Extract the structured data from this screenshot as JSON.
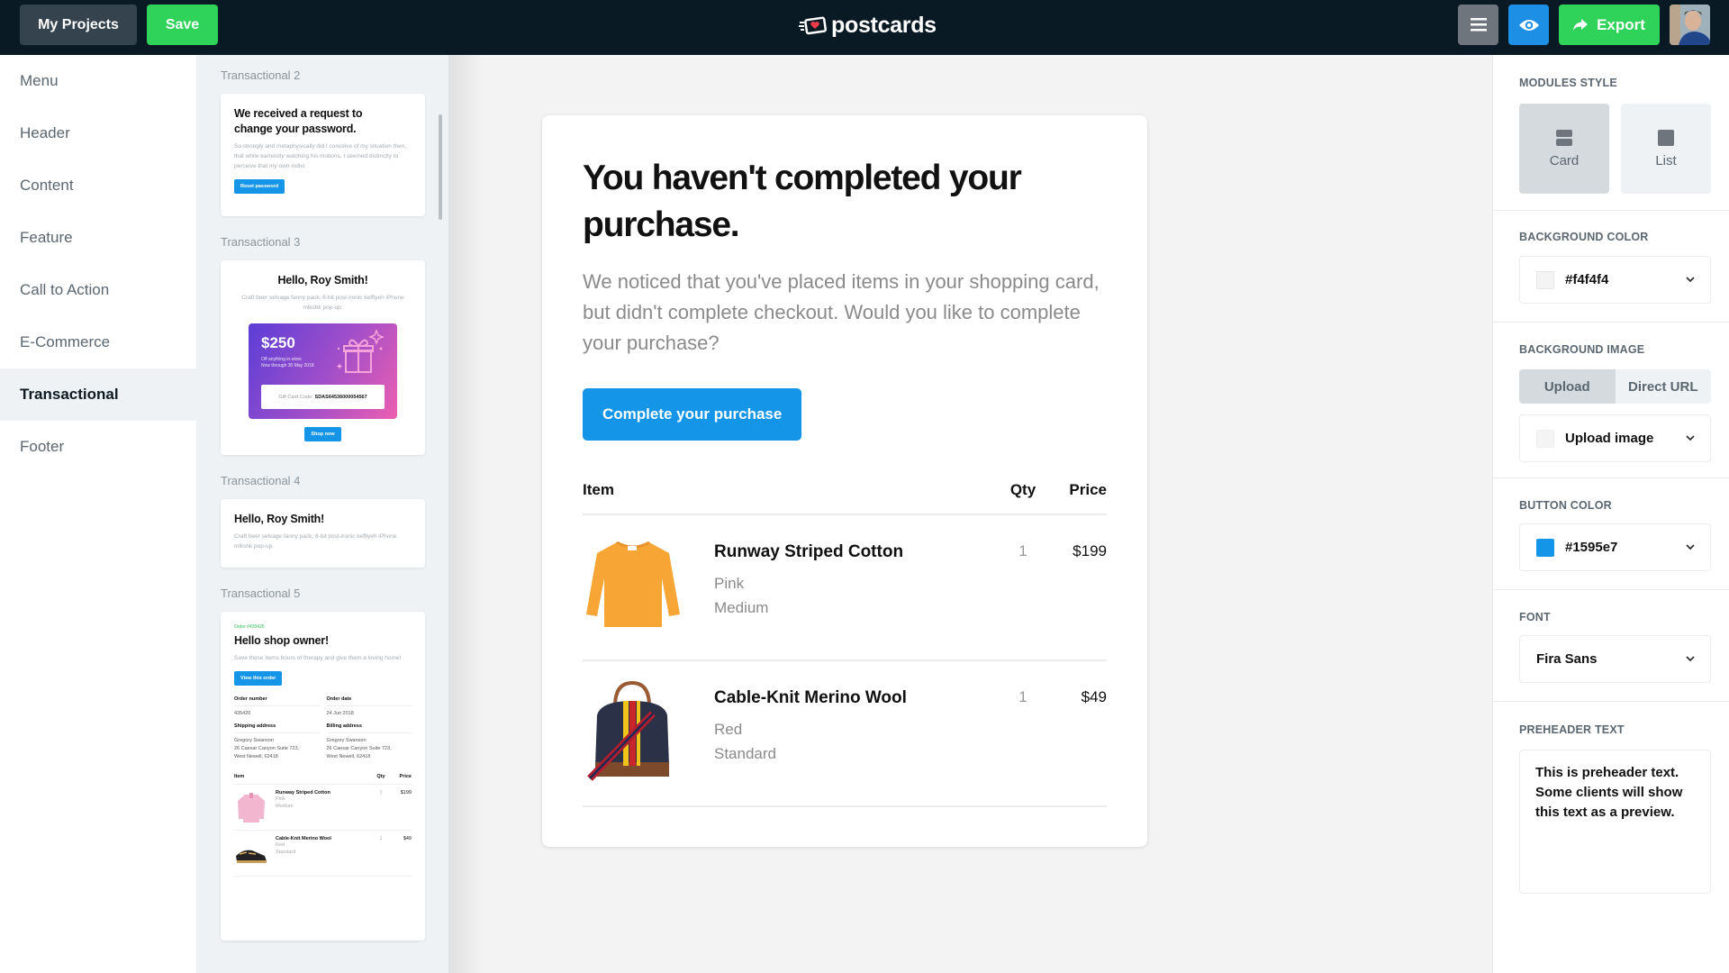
{
  "topbar": {
    "my_projects_label": "My Projects",
    "save_label": "Save",
    "logo_text": "postcards",
    "export_label": "Export"
  },
  "colors": {
    "topbar_bg": "#0a1a25",
    "save_green": "#2fd35a",
    "preview_blue": "#1d8fe4",
    "button_blue": "#1595e7"
  },
  "nav": {
    "items": [
      {
        "label": "Menu"
      },
      {
        "label": "Header"
      },
      {
        "label": "Content"
      },
      {
        "label": "Feature"
      },
      {
        "label": "Call to Action"
      },
      {
        "label": "E-Commerce"
      },
      {
        "label": "Transactional",
        "active": true
      },
      {
        "label": "Footer"
      }
    ]
  },
  "thumbnails": {
    "t2": {
      "label": "Transactional 2",
      "title": "We received a request to change your password.",
      "body": "So strongly and metaphysically did I conceive of my situation then, that while earnestly watching his motions, I seemed distinctly to perceive that my own indivi.",
      "button": "Reset password"
    },
    "t3": {
      "label": "Transactional 3",
      "title": "Hello, Roy Smith!",
      "body": "Craft beer selvage fanny pack, 8-bit post-ironic keffiyeh iPhone mlkshk pop-up.",
      "amount": "$250",
      "sub1": "Off anything in-store",
      "sub2": "Now through 30 May 2018",
      "code_label": "Gift Card Code:",
      "code_value": "SDAS64536000054567",
      "button": "Shop now"
    },
    "t4": {
      "label": "Transactional 4",
      "title": "Hello, Roy Smith!",
      "body": "Craft beer selvage fanny pack, 8-bit post-ironic keffiyeh iPhone mlkshk pop-up."
    },
    "t5": {
      "label": "Transactional 5",
      "order_tag": "Order #435426",
      "title": "Hello shop owner!",
      "body": "Save these items hours of therapy and give them a loving home!",
      "button": "View this order",
      "order_number_label": "Order number",
      "order_number": "435426",
      "order_date_label": "Order date",
      "order_date": "24 Jun 2018",
      "shipping_label": "Shipping address",
      "billing_label": "Billing address",
      "address_name": "Gregory Swanson",
      "address_line1": "26 Caesar Canyon Suite 723,",
      "address_line2": "West Newell, 62418",
      "col_item": "Item",
      "col_qty": "Qty",
      "col_price": "Price",
      "rows": [
        {
          "name": "Runway Striped Cotton",
          "color": "Pink",
          "size": "Medium",
          "qty": "1",
          "price": "$199"
        },
        {
          "name": "Cable-Knit Merino Wool",
          "color": "Red",
          "size": "Standard",
          "qty": "1",
          "price": "$49"
        }
      ]
    }
  },
  "email": {
    "title": "You haven't completed your purchase.",
    "body": "We noticed that you've placed items in your shopping card, but didn't complete checkout. Would you like to complete your purchase?",
    "cta": "Complete your purchase",
    "table": {
      "col_item": "Item",
      "col_qty": "Qty",
      "col_price": "Price",
      "rows": [
        {
          "name": "Runway Striped Cotton",
          "color": "Pink",
          "size": "Medium",
          "qty": "1",
          "price": "$199",
          "image": "orange-sweater"
        },
        {
          "name": "Cable-Knit Merino Wool",
          "color": "Red",
          "size": "Standard",
          "qty": "1",
          "price": "$49",
          "image": "striped-bag"
        }
      ]
    }
  },
  "settings": {
    "modules_style_label": "MODULES STYLE",
    "style_card": "Card",
    "style_list": "List",
    "style_selected": "Card",
    "bg_color_label": "BACKGROUND COLOR",
    "bg_color_value": "#f4f4f4",
    "bg_image_label": "BACKGROUND IMAGE",
    "bg_image_tab_upload": "Upload",
    "bg_image_tab_url": "Direct URL",
    "bg_image_selected_tab": "Upload",
    "bg_image_value": "Upload image",
    "button_color_label": "BUTTON COLOR",
    "button_color_value": "#1595e7",
    "font_label": "FONT",
    "font_value": "Fira Sans",
    "preheader_label": "PREHEADER TEXT",
    "preheader_value": "This is preheader text. Some clients will show this text as a preview."
  }
}
